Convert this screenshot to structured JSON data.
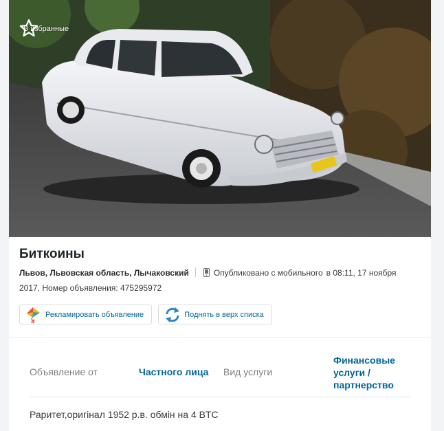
{
  "favorite": {
    "label": "В избранные"
  },
  "listing": {
    "title": "Биткоины",
    "location": "Львов, Львовская область, Лычаковский",
    "published_label": "Опубликовано с мобильного",
    "published_time": "в 08:11, 17 ноября",
    "published_year_and_id": "2017, Номер объявления: 475295972"
  },
  "actions": {
    "promote_label": "Рекламировать объявление",
    "bump_label": "Поднять в верх списка"
  },
  "details": {
    "offer_from_key": "Объявление от",
    "offer_from_value": "Частного лица",
    "service_type_key": "Вид услуги",
    "service_type_value": "Финансовые услуги / партнерство"
  },
  "description": "Раритет,оригінал 1952 р.в. обмін на 4 BTC",
  "colors": {
    "link": "#00669a",
    "title": "#1c2528"
  }
}
